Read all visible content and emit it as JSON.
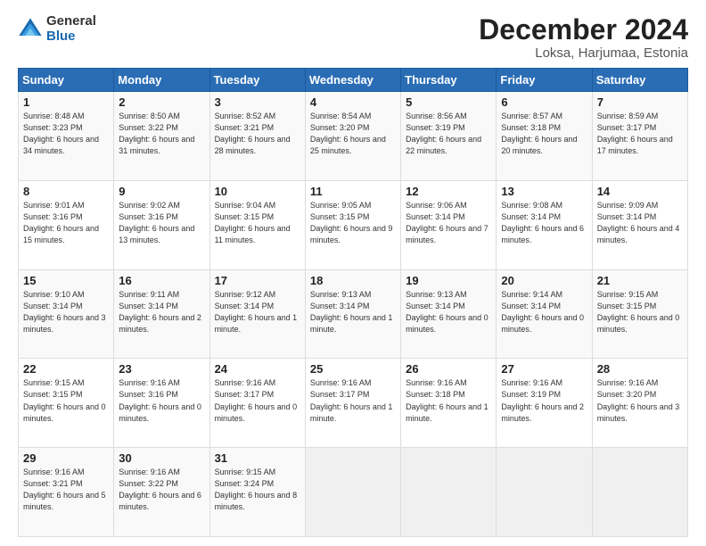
{
  "logo": {
    "general": "General",
    "blue": "Blue"
  },
  "title": "December 2024",
  "location": "Loksa, Harjumaa, Estonia",
  "days_of_week": [
    "Sunday",
    "Monday",
    "Tuesday",
    "Wednesday",
    "Thursday",
    "Friday",
    "Saturday"
  ],
  "weeks": [
    [
      {
        "day": "1",
        "sunrise": "8:48 AM",
        "sunset": "3:23 PM",
        "daylight": "6 hours and 34 minutes."
      },
      {
        "day": "2",
        "sunrise": "8:50 AM",
        "sunset": "3:22 PM",
        "daylight": "6 hours and 31 minutes."
      },
      {
        "day": "3",
        "sunrise": "8:52 AM",
        "sunset": "3:21 PM",
        "daylight": "6 hours and 28 minutes."
      },
      {
        "day": "4",
        "sunrise": "8:54 AM",
        "sunset": "3:20 PM",
        "daylight": "6 hours and 25 minutes."
      },
      {
        "day": "5",
        "sunrise": "8:56 AM",
        "sunset": "3:19 PM",
        "daylight": "6 hours and 22 minutes."
      },
      {
        "day": "6",
        "sunrise": "8:57 AM",
        "sunset": "3:18 PM",
        "daylight": "6 hours and 20 minutes."
      },
      {
        "day": "7",
        "sunrise": "8:59 AM",
        "sunset": "3:17 PM",
        "daylight": "6 hours and 17 minutes."
      }
    ],
    [
      {
        "day": "8",
        "sunrise": "9:01 AM",
        "sunset": "3:16 PM",
        "daylight": "6 hours and 15 minutes."
      },
      {
        "day": "9",
        "sunrise": "9:02 AM",
        "sunset": "3:16 PM",
        "daylight": "6 hours and 13 minutes."
      },
      {
        "day": "10",
        "sunrise": "9:04 AM",
        "sunset": "3:15 PM",
        "daylight": "6 hours and 11 minutes."
      },
      {
        "day": "11",
        "sunrise": "9:05 AM",
        "sunset": "3:15 PM",
        "daylight": "6 hours and 9 minutes."
      },
      {
        "day": "12",
        "sunrise": "9:06 AM",
        "sunset": "3:14 PM",
        "daylight": "6 hours and 7 minutes."
      },
      {
        "day": "13",
        "sunrise": "9:08 AM",
        "sunset": "3:14 PM",
        "daylight": "6 hours and 6 minutes."
      },
      {
        "day": "14",
        "sunrise": "9:09 AM",
        "sunset": "3:14 PM",
        "daylight": "6 hours and 4 minutes."
      }
    ],
    [
      {
        "day": "15",
        "sunrise": "9:10 AM",
        "sunset": "3:14 PM",
        "daylight": "6 hours and 3 minutes."
      },
      {
        "day": "16",
        "sunrise": "9:11 AM",
        "sunset": "3:14 PM",
        "daylight": "6 hours and 2 minutes."
      },
      {
        "day": "17",
        "sunrise": "9:12 AM",
        "sunset": "3:14 PM",
        "daylight": "6 hours and 1 minute."
      },
      {
        "day": "18",
        "sunrise": "9:13 AM",
        "sunset": "3:14 PM",
        "daylight": "6 hours and 1 minute."
      },
      {
        "day": "19",
        "sunrise": "9:13 AM",
        "sunset": "3:14 PM",
        "daylight": "6 hours and 0 minutes."
      },
      {
        "day": "20",
        "sunrise": "9:14 AM",
        "sunset": "3:14 PM",
        "daylight": "6 hours and 0 minutes."
      },
      {
        "day": "21",
        "sunrise": "9:15 AM",
        "sunset": "3:15 PM",
        "daylight": "6 hours and 0 minutes."
      }
    ],
    [
      {
        "day": "22",
        "sunrise": "9:15 AM",
        "sunset": "3:15 PM",
        "daylight": "6 hours and 0 minutes."
      },
      {
        "day": "23",
        "sunrise": "9:16 AM",
        "sunset": "3:16 PM",
        "daylight": "6 hours and 0 minutes."
      },
      {
        "day": "24",
        "sunrise": "9:16 AM",
        "sunset": "3:17 PM",
        "daylight": "6 hours and 0 minutes."
      },
      {
        "day": "25",
        "sunrise": "9:16 AM",
        "sunset": "3:17 PM",
        "daylight": "6 hours and 1 minute."
      },
      {
        "day": "26",
        "sunrise": "9:16 AM",
        "sunset": "3:18 PM",
        "daylight": "6 hours and 1 minute."
      },
      {
        "day": "27",
        "sunrise": "9:16 AM",
        "sunset": "3:19 PM",
        "daylight": "6 hours and 2 minutes."
      },
      {
        "day": "28",
        "sunrise": "9:16 AM",
        "sunset": "3:20 PM",
        "daylight": "6 hours and 3 minutes."
      }
    ],
    [
      {
        "day": "29",
        "sunrise": "9:16 AM",
        "sunset": "3:21 PM",
        "daylight": "6 hours and 5 minutes."
      },
      {
        "day": "30",
        "sunrise": "9:16 AM",
        "sunset": "3:22 PM",
        "daylight": "6 hours and 6 minutes."
      },
      {
        "day": "31",
        "sunrise": "9:15 AM",
        "sunset": "3:24 PM",
        "daylight": "6 hours and 8 minutes."
      },
      null,
      null,
      null,
      null
    ]
  ]
}
